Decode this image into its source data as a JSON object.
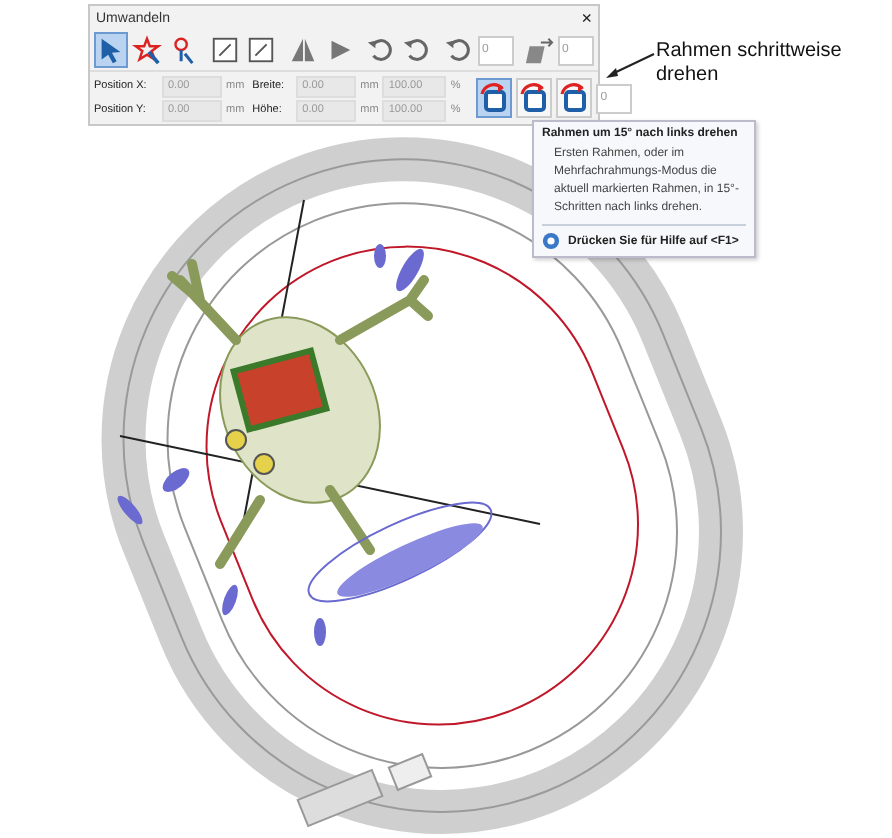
{
  "toolbar": {
    "title": "Umwandeln",
    "close": "×",
    "tools": [
      {
        "kind": "arrow",
        "selected": true
      },
      {
        "kind": "star",
        "selected": false
      },
      {
        "kind": "pin",
        "selected": false
      },
      {
        "kind": "separator"
      },
      {
        "kind": "square",
        "selected": false
      },
      {
        "kind": "square",
        "selected": false
      },
      {
        "kind": "separator"
      },
      {
        "kind": "triangle",
        "selected": false
      },
      {
        "kind": "triangle",
        "selected": false
      },
      {
        "kind": "separator"
      },
      {
        "kind": "rotate",
        "selected": false
      },
      {
        "kind": "rotate",
        "selected": false
      },
      {
        "kind": "separator"
      },
      {
        "kind": "rotate",
        "selected": false
      },
      {
        "kind": "field",
        "value": "0"
      },
      {
        "kind": "separator"
      },
      {
        "kind": "skew",
        "selected": false
      },
      {
        "kind": "field",
        "value": "0"
      }
    ],
    "position": [
      {
        "label": "Position X:",
        "value": "0.00",
        "unit": "mm",
        "disabled": true
      },
      {
        "label": "Position Y:",
        "value": "0.00",
        "unit": "mm",
        "disabled": true
      }
    ],
    "size": [
      {
        "label": "Breite:",
        "value": "0.00",
        "unit": "mm",
        "percent": "100.00",
        "percent_unit": "%",
        "disabled": true
      },
      {
        "label": "Höhe:",
        "value": "0.00",
        "unit": "mm",
        "percent": "100.00",
        "percent_unit": "%",
        "disabled": true
      }
    ],
    "frame_buttons": [
      {
        "selected": true
      },
      {
        "selected": false
      },
      {
        "selected": false
      }
    ],
    "frame_angle": "0"
  },
  "callout": "Rahmen schrittweise drehen",
  "tooltip": {
    "title": "Rahmen um 15° nach links drehen",
    "body": "Ersten Rahmen, oder im Mehrfachrahmungs-Modus die aktuell markierten Rahmen, in 15°-Schritten nach links drehen.",
    "help": "Drücken Sie für Hilfe auf <F1>"
  }
}
